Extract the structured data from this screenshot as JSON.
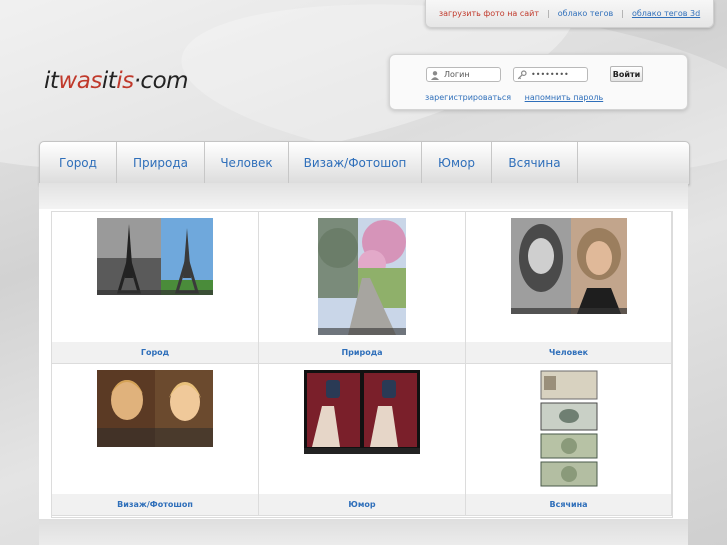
{
  "topbar": {
    "upload": "загрузить фото на сайт",
    "tag_cloud": "облако тегов",
    "tag_cloud_3d": "облако тегов 3d"
  },
  "logo": {
    "part1": "it",
    "part2": "was",
    "part3": "it",
    "part4": "is",
    "part5": "·com"
  },
  "login": {
    "login_placeholder": "Логин",
    "password_value": "••••••••",
    "button": "Войти",
    "register": "зарегистрироваться",
    "remind": "напомнить пароль"
  },
  "nav": {
    "items": [
      "Город",
      "Природа",
      "Человек",
      "Визаж/Фотошоп",
      "Юмор",
      "Всячина"
    ]
  },
  "categories": [
    {
      "caption": "Город"
    },
    {
      "caption": "Природа"
    },
    {
      "caption": "Человек"
    },
    {
      "caption": "Визаж/Фотошоп"
    },
    {
      "caption": "Юмор"
    },
    {
      "caption": "Всячина"
    }
  ],
  "colors": {
    "link": "#2f6fba",
    "accent": "#c0392b"
  }
}
